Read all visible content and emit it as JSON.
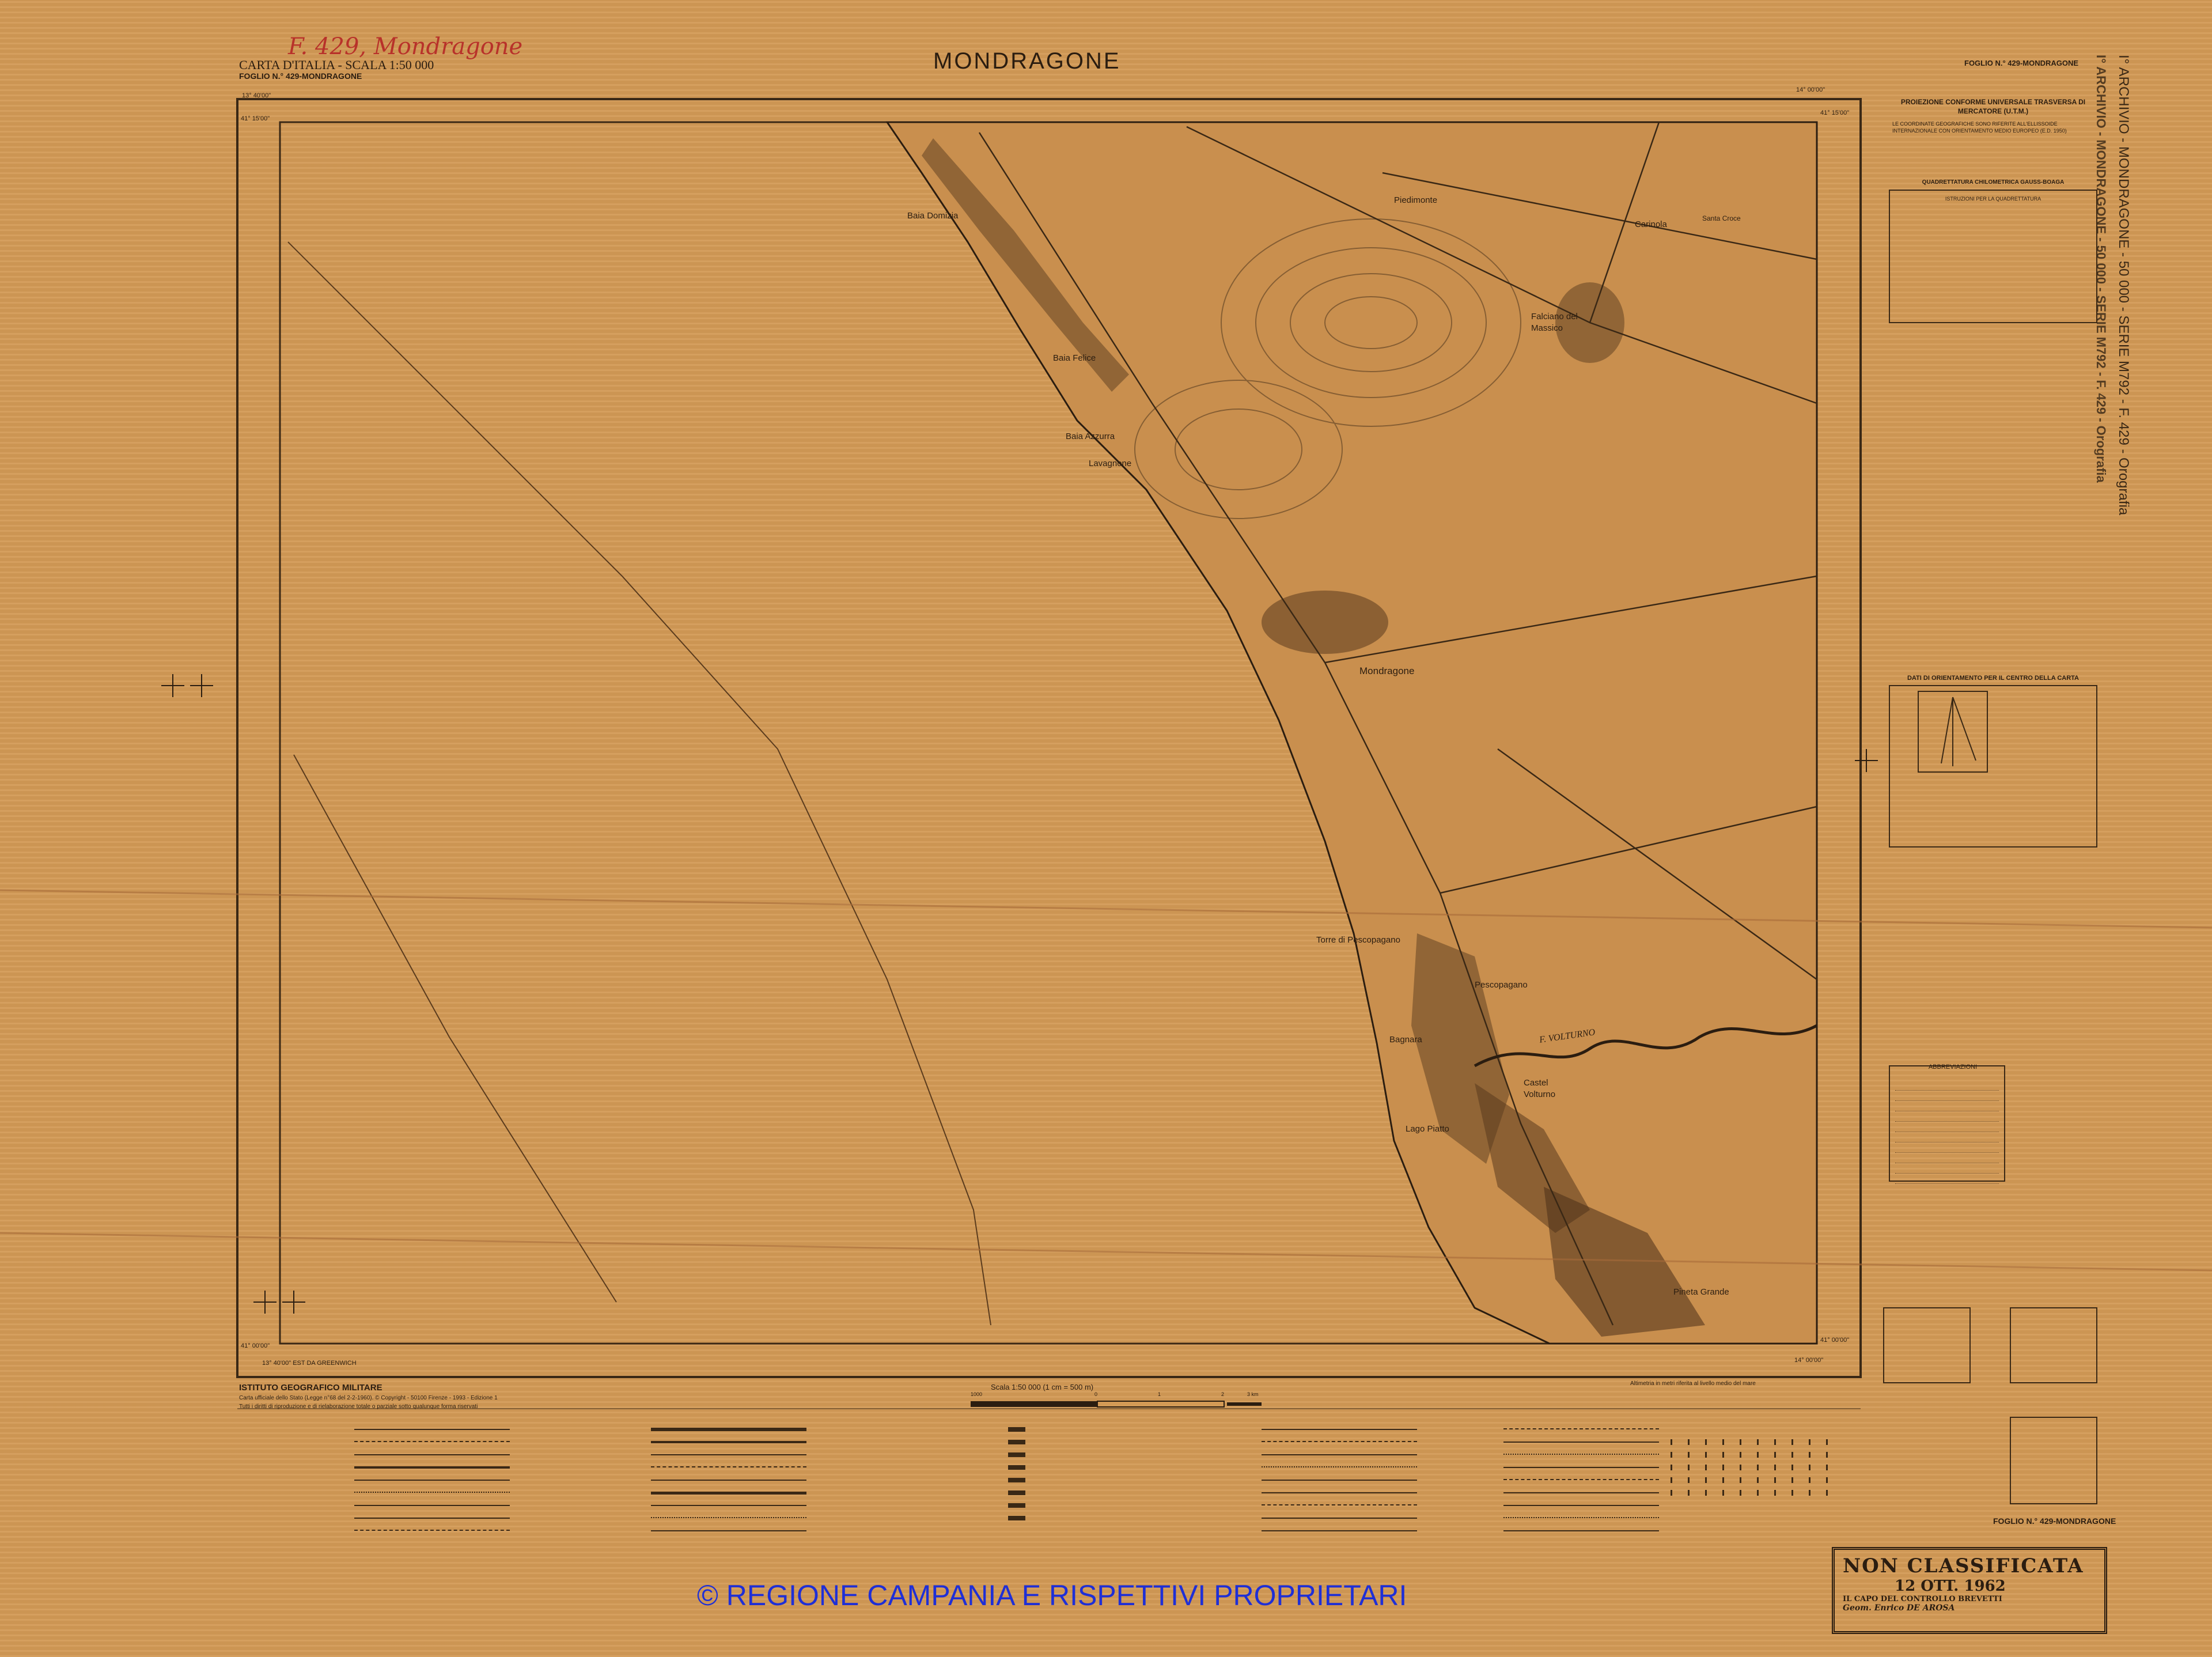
{
  "header": {
    "handwritten_note": "F. 429, Mondragone",
    "series_line_1": "CARTA D'ITALIA - SCALA 1:50 000",
    "series_line_2": "FOGLIO N.° 429-MONDRAGONE",
    "main_title": "MONDRAGONE",
    "sheet_label_top_right": "FOGLIO N.° 429-MONDRAGONE"
  },
  "coordinates": {
    "top_left_lon": "13° 40'00\"",
    "top_left_lat": "41° 15'00\"",
    "top_right_lon": "14° 00'00\"",
    "top_right_lat": "41° 15'00\"",
    "bottom_left_lat": "41° 00'00\"",
    "bottom_left_lon": "13° 40'00\"  EST DA GREENWICH",
    "bottom_right_lat": "41° 00'00\"",
    "bottom_right_lon": "14° 00'00\""
  },
  "place_names": {
    "baia_domizia": "Baia Domizia",
    "baia_felice": "Baia Felice",
    "baia_azzurra": "Baia Azzurra",
    "lavagnone": "Lavagnone",
    "mondragone": "Mondragone",
    "piedimonte": "Piedimonte",
    "falciano": "Falciano del Massico",
    "carinola": "Carinola",
    "torre_pescopagano": "Torre di Pescopagano",
    "pescopagano": "Pescopagano",
    "bagnara": "Bagnara",
    "volturno": "F. VOLTURNO",
    "castel_volturno": "Castel Volturno",
    "lago_piatto": "Lago Piatto",
    "pineta_grande": "Pineta Grande",
    "santa_croce": "Santa Croce"
  },
  "side_text": {
    "archive_vertical": "I° ARCHIVIO - MONDRAGONE - 50 000 - SERIE M792 - F. 429 - Orografia"
  },
  "right_panel": {
    "projection_title": "PROIEZIONE CONFORME UNIVERSALE TRASVERSA DI MERCATORE (U.T.M.)",
    "datum_note": "LE COORDINATE GEOGRAFICHE SONO RIFERITE ALL'ELLISSOIDE INTERNAZIONALE CON ORIENTAMENTO MEDIO EUROPEO (E.D. 1950)",
    "grid_title": "QUADRETTATURA CHILOMETRICA GAUSS-BOAGA",
    "grid_subtitle": "ISTRUZIONI PER LA QUADRETTATURA",
    "orientation_title": "DATI DI ORIENTAMENTO PER IL CENTRO DELLA CARTA",
    "abbreviations_title": "ABBREVIAZIONI"
  },
  "bottom_left": {
    "institute": "ISTITUTO GEOGRAFICO MILITARE",
    "copyright_note": "Carta ufficiale dello Stato (Legge n°68 del 2-2-1960). © Copyright - 50100 Firenze - 1993 - Edizione 1",
    "rights_note": "Tutti i diritti di riproduzione e di rielaborazione totale o parziale sotto qualunque forma riservati"
  },
  "scale_bar": {
    "label": "Scala 1:50 000 (1 cm = 500 m)",
    "ticks": [
      "1000",
      "0",
      "1",
      "2",
      "3 km"
    ]
  },
  "altitude_note": "Altimetria in metri riferita al livello medio del mare",
  "bottom_right": {
    "sheet_label": "FOGLIO N.° 429-MONDRAGONE",
    "stamp_line_1": "NON CLASSIFICATA",
    "stamp_line_2": "12 OTT. 1962",
    "stamp_line_3": "IL CAPO DEL CONTROLLO BREVETTI",
    "stamp_line_4": "Geom. Enrico DE AROSA"
  },
  "watermark": "© REGIONE CAMPANIA E RISPETTIVI PROPRIETARI",
  "colors": {
    "paper": "#d39a56",
    "ink": "#2b1d10",
    "handwriting": "#b8322a",
    "watermark": "#1f2fd6"
  }
}
